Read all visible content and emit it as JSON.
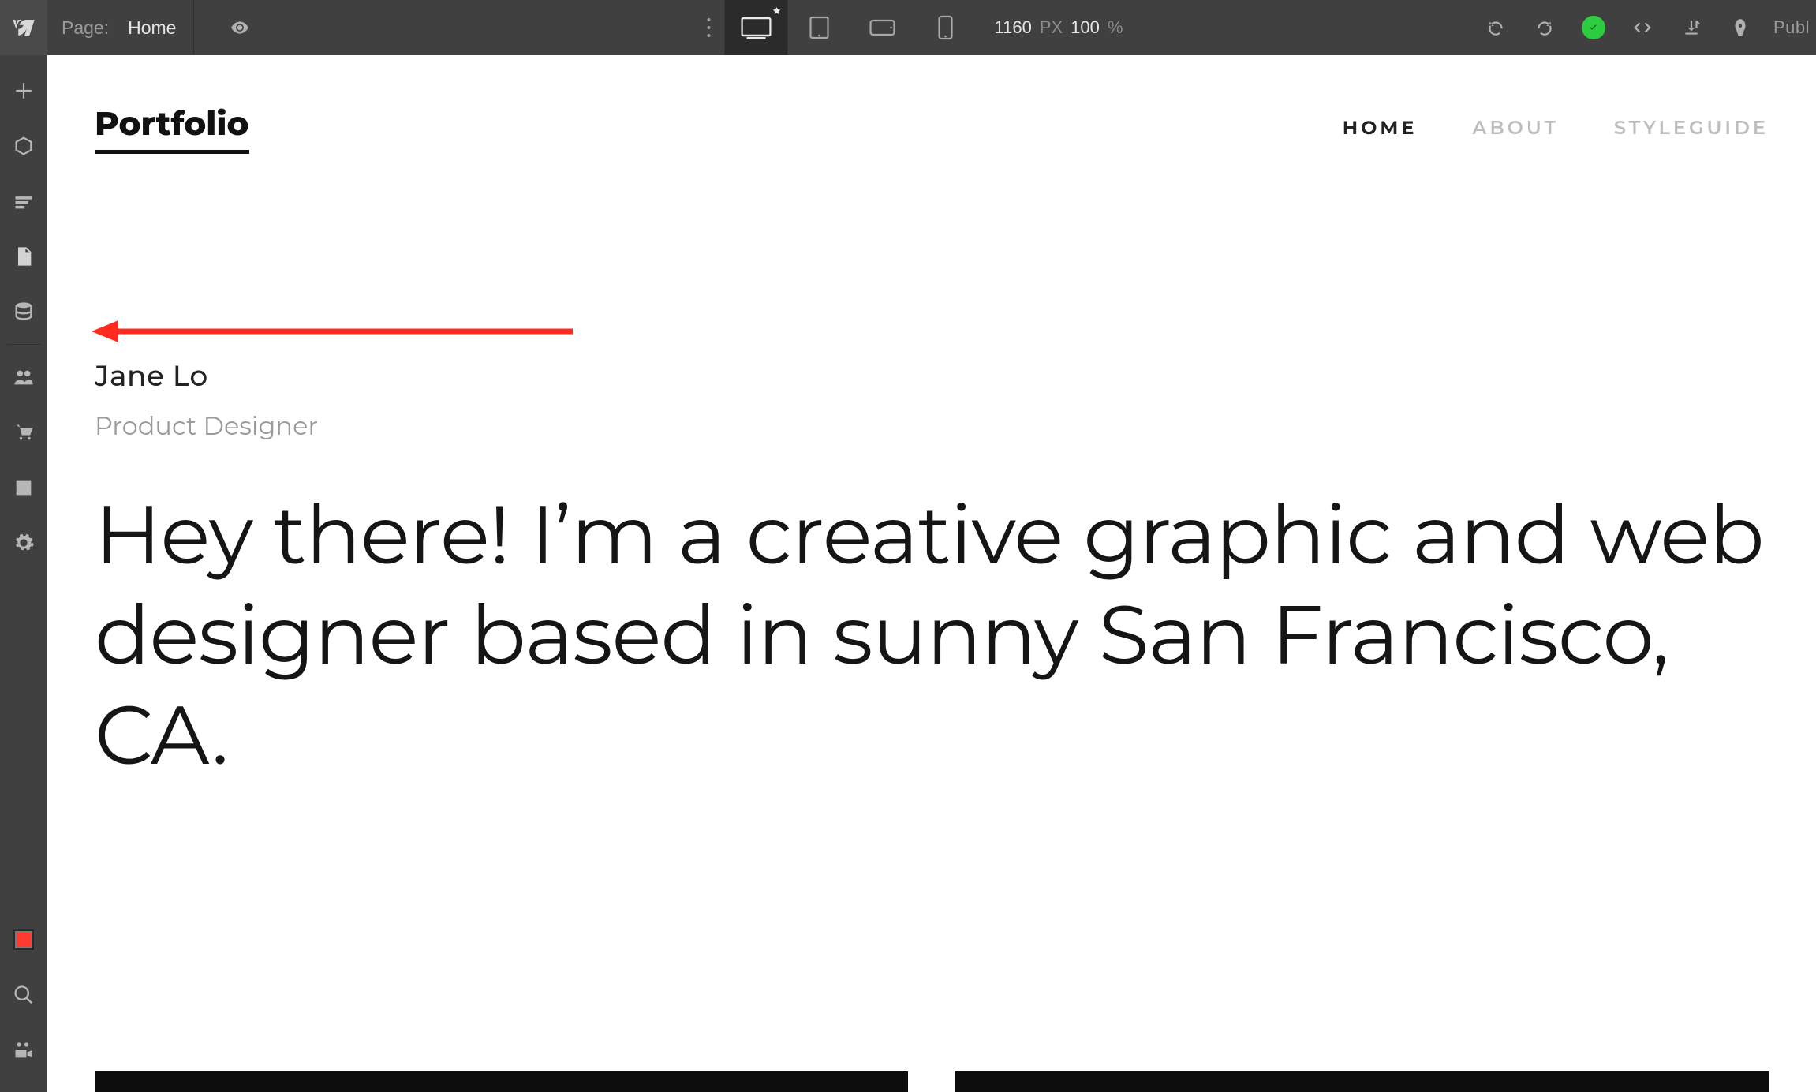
{
  "topbar": {
    "page_label": "Page:",
    "page_name": "Home",
    "width_value": "1160",
    "width_unit": "PX",
    "zoom_value": "100",
    "zoom_unit": "%",
    "publish_label": "Publ"
  },
  "leftbar": {
    "items": [
      {
        "id": "add",
        "label": "Add"
      },
      {
        "id": "symbols",
        "label": "Symbols"
      },
      {
        "id": "navigator",
        "label": "Navigator"
      },
      {
        "id": "pages",
        "label": "Pages"
      },
      {
        "id": "cms",
        "label": "CMS"
      },
      {
        "id": "users",
        "label": "Users"
      },
      {
        "id": "ecommerce",
        "label": "Ecommerce"
      },
      {
        "id": "assets",
        "label": "Assets"
      },
      {
        "id": "settings",
        "label": "Settings"
      }
    ],
    "bottom": [
      {
        "id": "audit",
        "label": "Audit"
      },
      {
        "id": "search",
        "label": "Search"
      },
      {
        "id": "video",
        "label": "Video"
      }
    ]
  },
  "site": {
    "brand": "Portfolio",
    "nav": [
      {
        "label": "HOME",
        "active": true
      },
      {
        "label": "ABOUT",
        "active": false
      },
      {
        "label": "STYLEGUIDE",
        "active": false
      }
    ],
    "hero": {
      "name": "Jane Lo",
      "role": "Product Designer",
      "headline": "Hey there! I’m a creative graphic and web designer based in sunny San Francisco, CA."
    }
  }
}
